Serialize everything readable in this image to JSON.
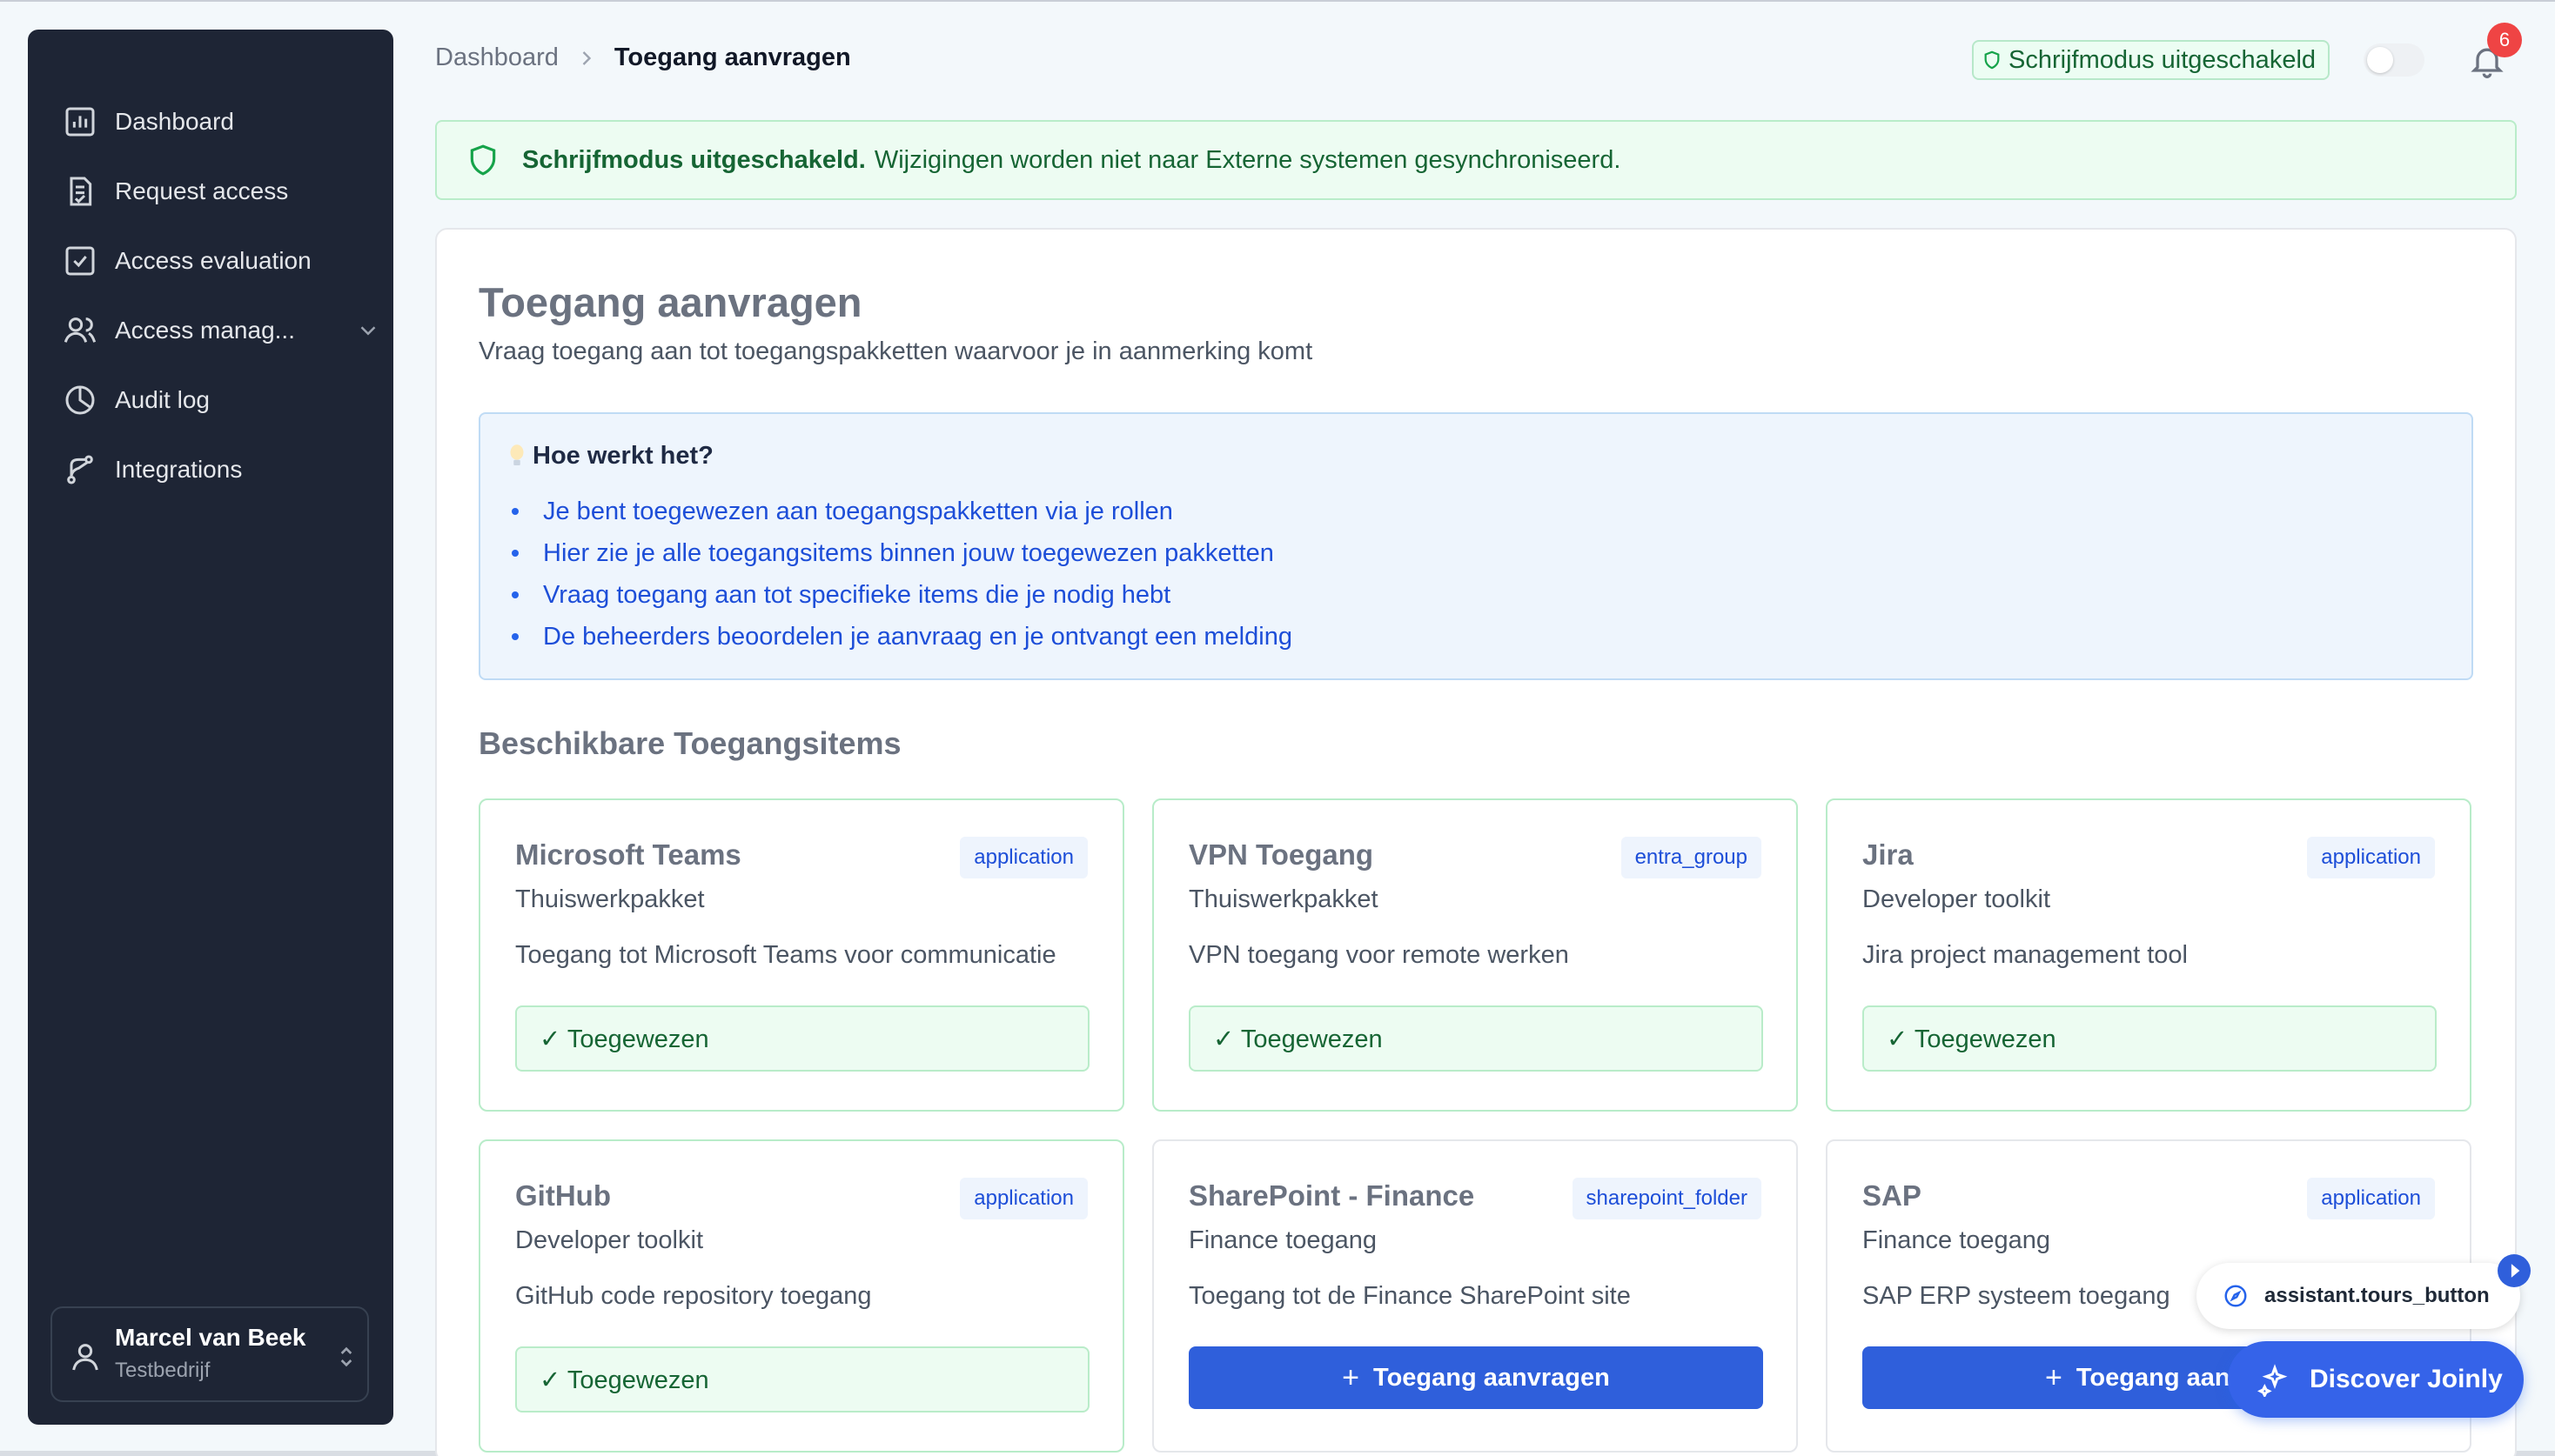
{
  "sidebar": {
    "items": [
      {
        "label": "Dashboard",
        "icon": "bar-chart-icon"
      },
      {
        "label": "Request access",
        "icon": "document-check-icon"
      },
      {
        "label": "Access evaluation",
        "icon": "checkbox-icon"
      },
      {
        "label": "Access manag...",
        "icon": "users-icon"
      },
      {
        "label": "Audit log",
        "icon": "pie-chart-icon"
      },
      {
        "label": "Integrations",
        "icon": "git-branch-icon"
      }
    ],
    "user": {
      "name": "Marcel van Beek",
      "company": "Testbedrijf"
    }
  },
  "header": {
    "breadcrumb": {
      "root": "Dashboard",
      "current": "Toegang aanvragen"
    },
    "write_badge": "Schrijfmodus uitgeschakeld",
    "notifications_count": "6"
  },
  "alert": {
    "strong": "Schrijfmodus uitgeschakeld.",
    "text": "Wijzigingen worden niet naar Externe systemen gesynchroniseerd."
  },
  "page": {
    "title": "Toegang aanvragen",
    "subtitle": "Vraag toegang aan tot toegangspakketten waarvoor je in aanmerking komt"
  },
  "info": {
    "heading": "Hoe werkt het?",
    "items": [
      "Je bent toegewezen aan toegangspakketten via je rollen",
      "Hier zie je alle toegangsitems binnen jouw toegewezen pakketten",
      "Vraag toegang aan tot specifieke items die je nodig hebt",
      "De beheerders beoordelen je aanvraag en je ontvangt een melding"
    ]
  },
  "section": {
    "title": "Beschikbare Toegangsitems"
  },
  "cards": [
    {
      "name": "Microsoft Teams",
      "tag": "application",
      "package": "Thuiswerkpakket",
      "description": "Toegang tot Microsoft Teams voor communicatie",
      "action": "✓ Toegewezen"
    },
    {
      "name": "VPN Toegang",
      "tag": "entra_group",
      "package": "Thuiswerkpakket",
      "description": "VPN toegang voor remote werken",
      "action": "✓ Toegewezen"
    },
    {
      "name": "Jira",
      "tag": "application",
      "package": "Developer toolkit",
      "description": "Jira project management tool",
      "action": "✓ Toegewezen"
    },
    {
      "name": "GitHub",
      "tag": "application",
      "package": "Developer toolkit",
      "description": "GitHub code repository toegang",
      "action": "✓ Toegewezen"
    },
    {
      "name": "SharePoint - Finance",
      "tag": "sharepoint_folder",
      "package": "Finance toegang",
      "description": "Toegang tot de Finance SharePoint site",
      "action": "Toegang aanvragen"
    },
    {
      "name": "SAP",
      "tag": "application",
      "package": "Finance toegang",
      "description": "SAP ERP systeem toegang",
      "action": "Toegang aanvr"
    }
  ],
  "assistant": {
    "tours_label": "assistant.tours_button",
    "discover_label": "Discover Joinly"
  },
  "colors": {
    "sidebar_bg": "#1e2535",
    "accent": "#2f5fdb",
    "success": "#166534",
    "badge_red": "#ef4444"
  }
}
